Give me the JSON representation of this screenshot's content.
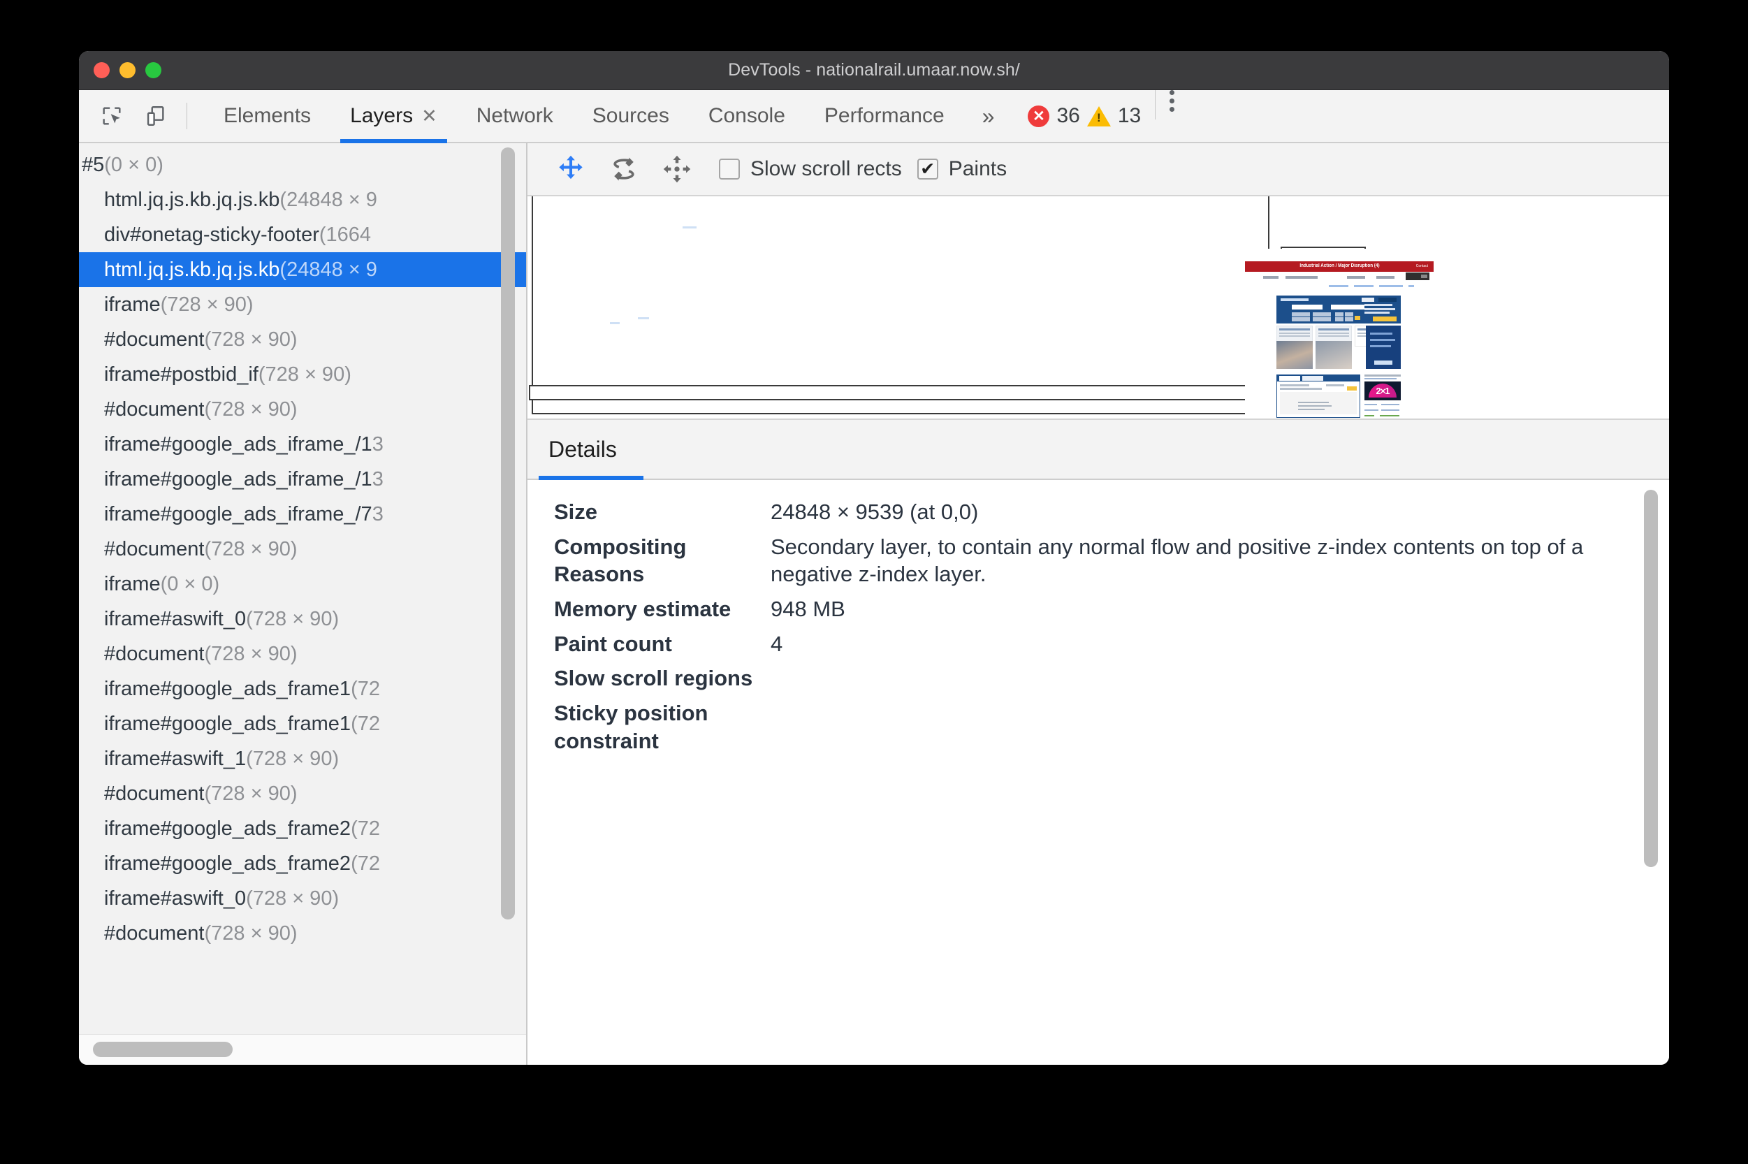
{
  "window": {
    "title": "DevTools - nationalrail.umaar.now.sh/",
    "traffic_lights": [
      "close",
      "minimize",
      "zoom"
    ]
  },
  "toolbar_left": {
    "inspect_icon": "inspect-element-icon",
    "device_icon": "device-toolbar-icon"
  },
  "tabs": [
    {
      "label": "Elements",
      "active": false,
      "closable": false
    },
    {
      "label": "Layers",
      "active": true,
      "closable": true,
      "close_label": "✕"
    },
    {
      "label": "Network",
      "active": false,
      "closable": false
    },
    {
      "label": "Sources",
      "active": false,
      "closable": false
    },
    {
      "label": "Console",
      "active": false,
      "closable": false
    },
    {
      "label": "Performance",
      "active": false,
      "closable": false
    }
  ],
  "overflow": {
    "label": "»"
  },
  "counters": {
    "error_count": "36",
    "warning_count": "13",
    "error_glyph": "✕",
    "warning_glyph": "!"
  },
  "more_menu": {
    "label": "kebab-menu"
  },
  "layer_tree": {
    "nodes": [
      {
        "name": "#5",
        "size": "(0 × 0)",
        "indent": 0,
        "selected": false
      },
      {
        "name": "html.jq.js.kb.jq.js.kb",
        "size": "(24848 × 9",
        "indent": 1,
        "selected": false
      },
      {
        "name": "div#onetag-sticky-footer",
        "size": "(1664",
        "indent": 1,
        "selected": false
      },
      {
        "name": "html.jq.js.kb.jq.js.kb",
        "size": "(24848 × 9",
        "indent": 1,
        "selected": true
      },
      {
        "name": "iframe",
        "size": "(728 × 90)",
        "indent": 1,
        "selected": false
      },
      {
        "name": "#document",
        "size": "(728 × 90)",
        "indent": 1,
        "selected": false
      },
      {
        "name": "iframe#postbid_if",
        "size": "(728 × 90)",
        "indent": 1,
        "selected": false
      },
      {
        "name": "#document",
        "size": "(728 × 90)",
        "indent": 1,
        "selected": false
      },
      {
        "name": "iframe#google_ads_iframe_/1",
        "size": "3",
        "indent": 1,
        "selected": false
      },
      {
        "name": "iframe#google_ads_iframe_/1",
        "size": "3",
        "indent": 1,
        "selected": false
      },
      {
        "name": "iframe#google_ads_iframe_/7",
        "size": "3",
        "indent": 1,
        "selected": false
      },
      {
        "name": "#document",
        "size": "(728 × 90)",
        "indent": 1,
        "selected": false
      },
      {
        "name": "iframe",
        "size": "(0 × 0)",
        "indent": 1,
        "selected": false
      },
      {
        "name": "iframe#aswift_0",
        "size": "(728 × 90)",
        "indent": 1,
        "selected": false
      },
      {
        "name": "#document",
        "size": "(728 × 90)",
        "indent": 1,
        "selected": false
      },
      {
        "name": "iframe#google_ads_frame1",
        "size": "(72",
        "indent": 1,
        "selected": false
      },
      {
        "name": "iframe#google_ads_frame1",
        "size": "(72",
        "indent": 1,
        "selected": false
      },
      {
        "name": "iframe#aswift_1",
        "size": "(728 × 90)",
        "indent": 1,
        "selected": false
      },
      {
        "name": "#document",
        "size": "(728 × 90)",
        "indent": 1,
        "selected": false
      },
      {
        "name": "iframe#google_ads_frame2",
        "size": "(72",
        "indent": 1,
        "selected": false
      },
      {
        "name": "iframe#google_ads_frame2",
        "size": "(72",
        "indent": 1,
        "selected": false
      },
      {
        "name": "iframe#aswift_0",
        "size": "(728 × 90)",
        "indent": 1,
        "selected": false
      },
      {
        "name": "#document",
        "size": "(728 × 90)",
        "indent": 1,
        "selected": false
      }
    ]
  },
  "layers_toolbar": {
    "pan_icon": "pan-mode-icon",
    "rotate_icon": "rotate-mode-icon",
    "reset_icon": "reset-transform-icon",
    "slow_scroll_rects": {
      "label": "Slow scroll rects",
      "checked": false,
      "mark": ""
    },
    "paints": {
      "label": "Paints",
      "checked": true,
      "mark": "✔"
    }
  },
  "page_preview": {
    "site_banner_title": "Industrial Action / Major Disruption (4)",
    "banner_right": "Contact",
    "promo_number": "2×1"
  },
  "details": {
    "tab_label": "Details",
    "rows": [
      {
        "key": "Size",
        "value": "24848 × 9539 (at 0,0)"
      },
      {
        "key": "Compositing Reasons",
        "value": "Secondary layer, to contain any normal flow and positive z-index contents on top of a negative z-index layer."
      },
      {
        "key": "Memory estimate",
        "value": "948 MB"
      },
      {
        "key": "Paint count",
        "value": "4"
      },
      {
        "key": "Slow scroll regions",
        "value": ""
      },
      {
        "key": "Sticky position constraint",
        "value": ""
      }
    ]
  },
  "colors": {
    "accent": "#1a73e8",
    "error": "#ef3b3b",
    "warning": "#fbbc04",
    "titlebar": "#3b3b3d",
    "panel": "#f3f3f3"
  }
}
